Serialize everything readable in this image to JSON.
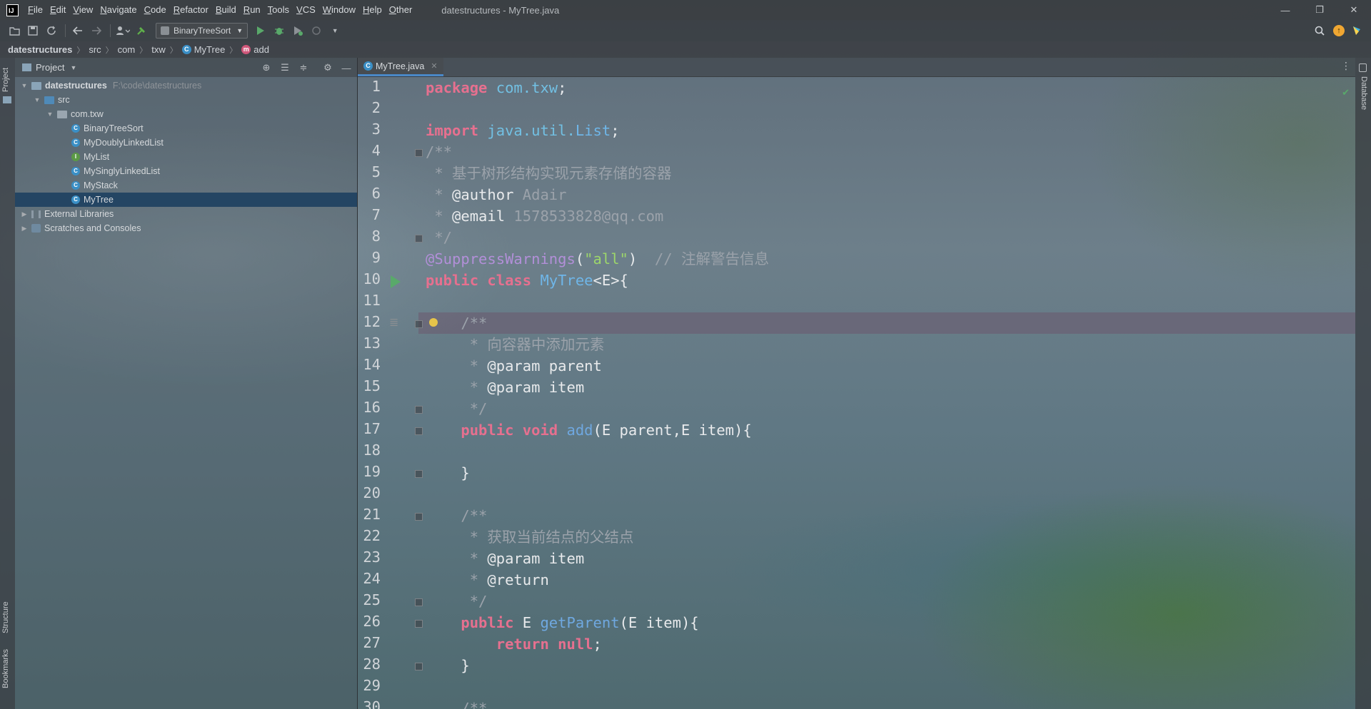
{
  "app": {
    "logo_text": "IJ",
    "window_title": "datestructures - MyTree.java"
  },
  "menu": [
    "File",
    "Edit",
    "View",
    "Navigate",
    "Code",
    "Refactor",
    "Build",
    "Run",
    "Tools",
    "VCS",
    "Window",
    "Help",
    "Other"
  ],
  "window_controls": {
    "minimize": "—",
    "restore": "❐",
    "close": "✕"
  },
  "toolbar": {
    "run_config": "BinaryTreeSort"
  },
  "breadcrumb": [
    "datestructures",
    "src",
    "com",
    "txw",
    "MyTree",
    "add"
  ],
  "left_stripe": {
    "project": "Project",
    "structure": "Structure",
    "bookmarks": "Bookmarks"
  },
  "right_stripe": {
    "database": "Database"
  },
  "project_panel": {
    "title": "Project",
    "root": {
      "name": "datestructures",
      "path": "F:\\code\\datestructures"
    },
    "src": "src",
    "package": "com.txw",
    "files": [
      {
        "name": "BinaryTreeSort",
        "kind": "class"
      },
      {
        "name": "MyDoublyLinkedList",
        "kind": "class"
      },
      {
        "name": "MyList",
        "kind": "interface"
      },
      {
        "name": "MySinglyLinkedList",
        "kind": "class"
      },
      {
        "name": "MyStack",
        "kind": "class"
      },
      {
        "name": "MyTree",
        "kind": "class"
      }
    ],
    "external_libraries": "External Libraries",
    "scratches": "Scratches and Consoles"
  },
  "editor": {
    "tab": "MyTree.java",
    "line_numbers": [
      "1",
      "2",
      "3",
      "4",
      "5",
      "6",
      "7",
      "8",
      "9",
      "10",
      "11",
      "12",
      "13",
      "14",
      "15",
      "16",
      "17",
      "18",
      "19",
      "20",
      "21",
      "22",
      "23",
      "24",
      "25",
      "26",
      "27",
      "28",
      "29",
      "30"
    ],
    "code": {
      "l1_kw": "package",
      "l1_pkg": "com.txw",
      "l1_end": ";",
      "l3_kw": "import",
      "l3_pkg": "java.util.",
      "l3_cls": "List",
      "l3_end": ";",
      "l4": "/**",
      "l5": " * 基于树形结构实现元素存储的容器",
      "l6_star": " * ",
      "l6_tag": "@author",
      "l6_val": " Adair",
      "l7_star": " * ",
      "l7_tag": "@email",
      "l7_val": " 1578533828@qq.com",
      "l8": " */",
      "l9_ann": "@SuppressWarnings",
      "l9_p1": "(",
      "l9_str": "\"all\"",
      "l9_p2": ")",
      "l9_cmt": "  // 注解警告信息",
      "l10_kw": "public class ",
      "l10_cls": "MyTree",
      "l10_rest": "<E>{",
      "l12": "    /**",
      "l13": "     * 向容器中添加元素",
      "l14_star": "     * ",
      "l14_tag": "@param",
      "l14_val": " parent",
      "l15_star": "     * ",
      "l15_tag": "@param",
      "l15_val": " item",
      "l16": "     */",
      "l17_kw": "    public void ",
      "l17_meth": "add",
      "l17_rest": "(E parent,E item){",
      "l19": "    }",
      "l21": "    /**",
      "l22": "     * 获取当前结点的父结点",
      "l23_star": "     * ",
      "l23_tag": "@param",
      "l23_val": " item",
      "l24_star": "     * ",
      "l24_tag": "@return",
      "l25": "     */",
      "l26_kw": "    public ",
      "l26_type": "E ",
      "l26_meth": "getParent",
      "l26_rest": "(E item){",
      "l27_kw": "        return null",
      "l27_end": ";",
      "l28": "    }",
      "l30": "    /**"
    }
  }
}
